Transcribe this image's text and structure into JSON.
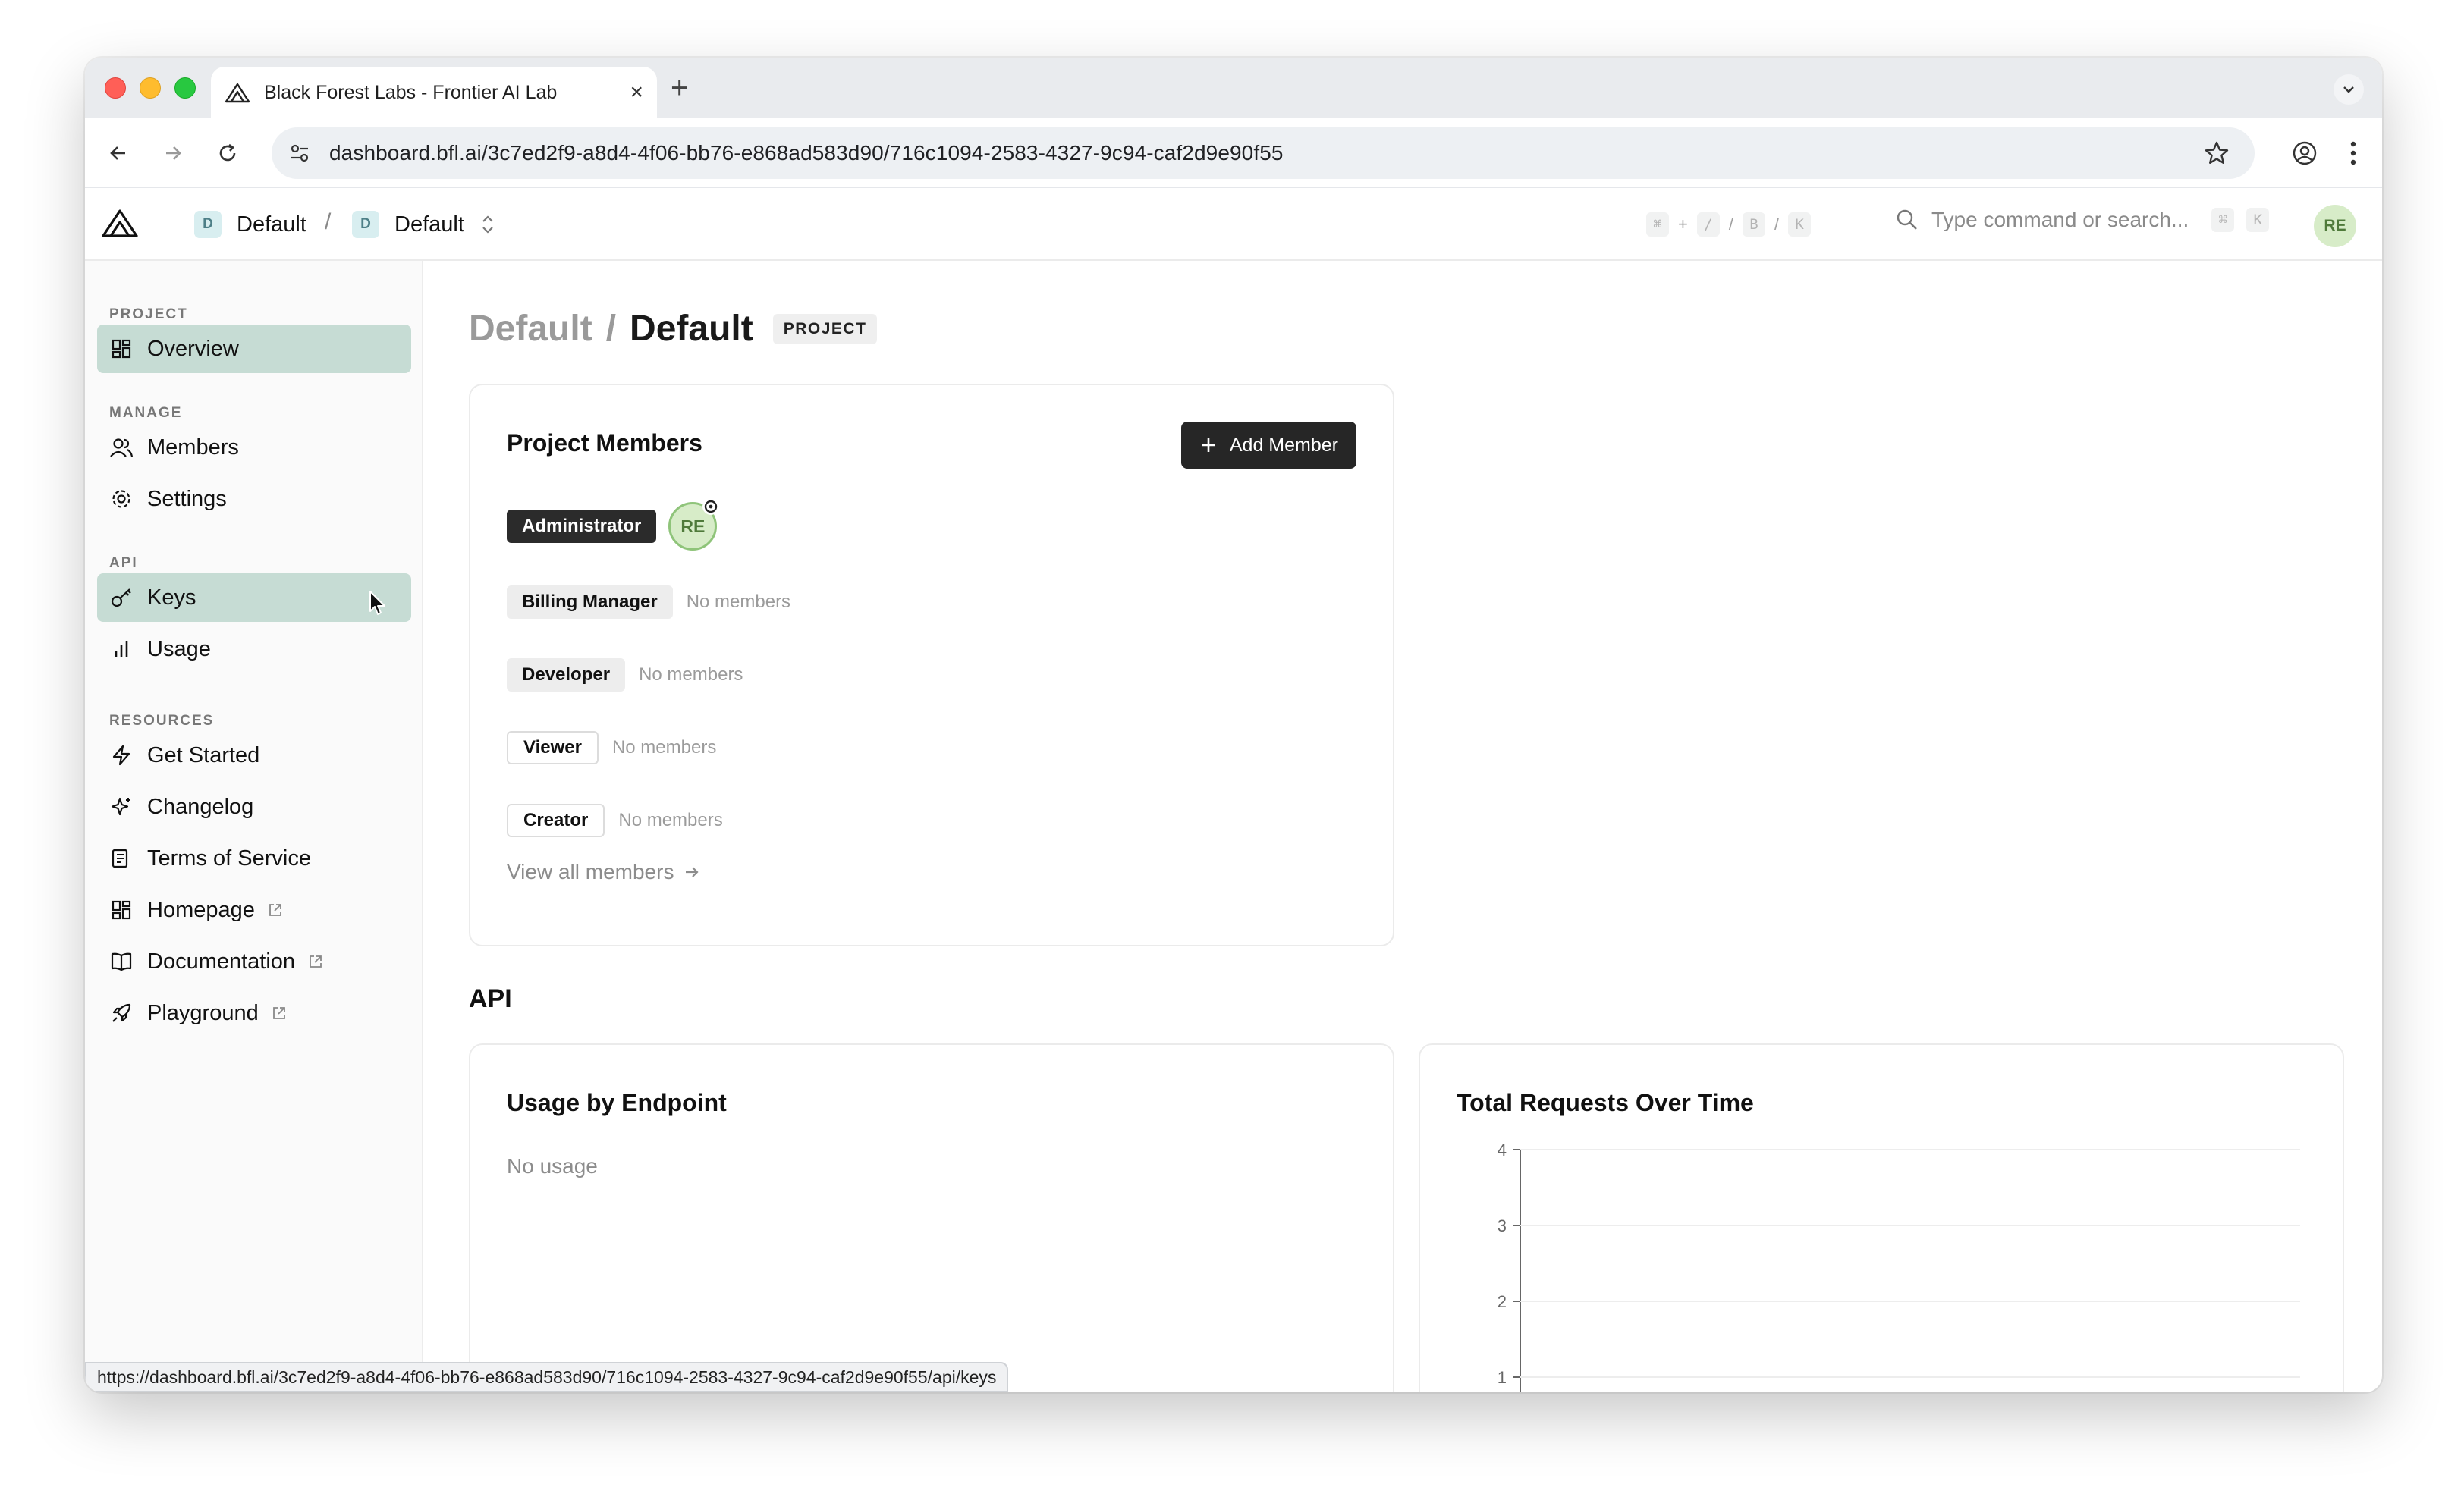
{
  "browser": {
    "tab_title": "Black Forest Labs - Frontier AI Lab",
    "url": "dashboard.bfl.ai/3c7ed2f9-a8d4-4f06-bb76-e868ad583d90/716c1094-2583-4327-9c94-caf2d9e90f55",
    "status_url": "https://dashboard.bfl.ai/3c7ed2f9-a8d4-4f06-bb76-e868ad583d90/716c1094-2583-4327-9c94-caf2d9e90f55/api/keys"
  },
  "header": {
    "org_badge": "D",
    "org_name": "Default",
    "crumb_sep": "/",
    "project_badge": "D",
    "project_name": "Default",
    "shortcut_keys": [
      "⌘",
      "+",
      "/",
      "/",
      "B",
      "/",
      "K"
    ],
    "search_placeholder": "Type command or search...",
    "search_keys": [
      "⌘",
      "K"
    ],
    "avatar": "RE"
  },
  "sidebar": {
    "sections": [
      {
        "title": "PROJECT",
        "items": [
          {
            "label": "Overview",
            "icon": "grid-icon",
            "active": true
          }
        ]
      },
      {
        "title": "MANAGE",
        "items": [
          {
            "label": "Members",
            "icon": "users-icon"
          },
          {
            "label": "Settings",
            "icon": "gear-icon"
          }
        ]
      },
      {
        "title": "API",
        "items": [
          {
            "label": "Keys",
            "icon": "key-icon",
            "hover": true
          },
          {
            "label": "Usage",
            "icon": "bar-chart-icon"
          }
        ]
      },
      {
        "title": "RESOURCES",
        "items": [
          {
            "label": "Get Started",
            "icon": "zap-icon"
          },
          {
            "label": "Changelog",
            "icon": "sparkles-icon"
          },
          {
            "label": "Terms of Service",
            "icon": "scroll-icon"
          },
          {
            "label": "Homepage",
            "icon": "grid-icon",
            "external": true
          },
          {
            "label": "Documentation",
            "icon": "book-icon",
            "external": true
          },
          {
            "label": "Playground",
            "icon": "rocket-icon",
            "external": true
          }
        ]
      }
    ]
  },
  "main": {
    "title_org": "Default",
    "title_sep": "/",
    "title_project": "Default",
    "title_badge": "PROJECT",
    "members_card": {
      "title": "Project Members",
      "add_button": "Add Member",
      "roles": [
        {
          "name": "Administrator",
          "style": "dark",
          "members": [
            "RE"
          ]
        },
        {
          "name": "Billing Manager",
          "style": "grey",
          "empty": "No members"
        },
        {
          "name": "Developer",
          "style": "grey",
          "empty": "No members"
        },
        {
          "name": "Viewer",
          "style": "outline",
          "empty": "No members"
        },
        {
          "name": "Creator",
          "style": "outline",
          "empty": "No members"
        }
      ],
      "view_all": "View all members"
    },
    "api_heading": "API",
    "usage_card": {
      "title": "Usage by Endpoint",
      "empty": "No usage"
    },
    "requests_card": {
      "title": "Total Requests Over Time"
    }
  },
  "chart_data": {
    "type": "line",
    "title": "Total Requests Over Time",
    "xlabel": "",
    "ylabel": "",
    "y_ticks": [
      1,
      2,
      3,
      4
    ],
    "ylim": [
      1,
      4
    ],
    "grid": true,
    "series": []
  },
  "colors": {
    "active_nav": "#c6dcd4",
    "primary_button": "#262626",
    "avatar_bg": "#d7ecc8"
  }
}
